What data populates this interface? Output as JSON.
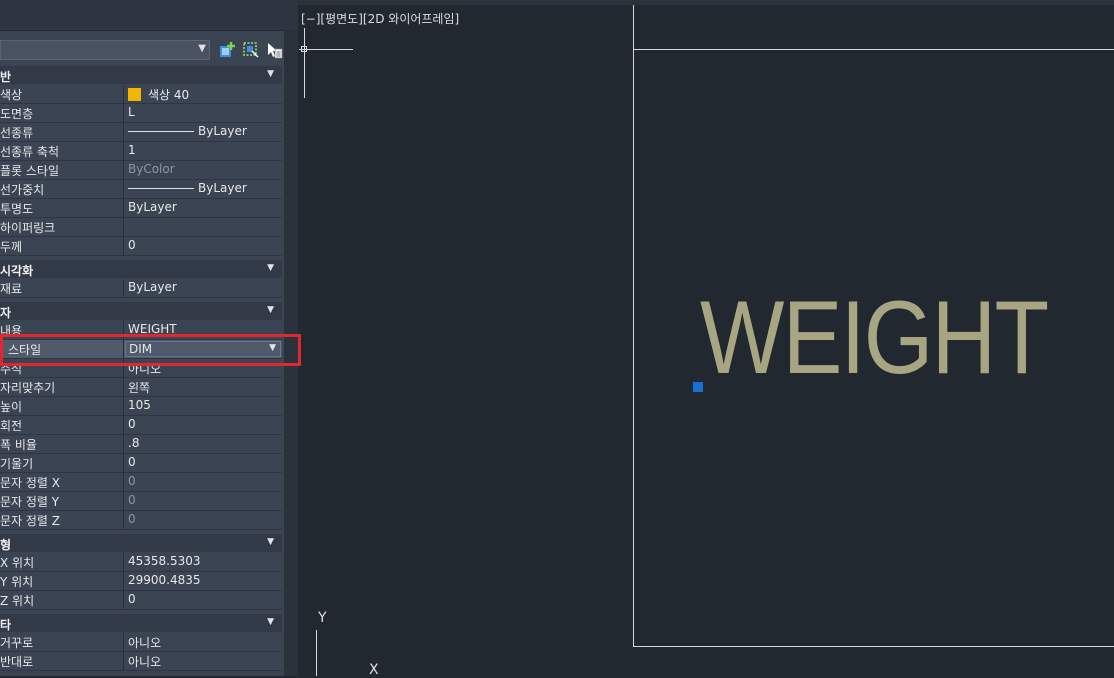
{
  "viewport": {
    "label": "[−][평면도][2D 와이어프레임]"
  },
  "canvas_text": "WEIGHT",
  "palette": {
    "categories": {
      "general": "반",
      "visualization": "시각화",
      "text": "자",
      "geometry": "형",
      "misc": "타"
    },
    "general_rows": [
      {
        "key": "색상",
        "value": "색상 40"
      },
      {
        "key": "도면층",
        "value": "L"
      },
      {
        "key": "선종류",
        "value": "ByLayer"
      },
      {
        "key": "선종류 축척",
        "value": "1"
      },
      {
        "key": "플롯 스타일",
        "value": "ByColor"
      },
      {
        "key": "선가중치",
        "value": "ByLayer"
      },
      {
        "key": "투명도",
        "value": "ByLayer"
      },
      {
        "key": "하이퍼링크",
        "value": ""
      },
      {
        "key": "두께",
        "value": "0"
      }
    ],
    "visual_rows": [
      {
        "key": "재료",
        "value": "ByLayer"
      }
    ],
    "text_rows": [
      {
        "key": "내용",
        "value": "WEIGHT"
      },
      {
        "key": "스타일",
        "value": "DIM"
      },
      {
        "key": "주석",
        "value": "아니오"
      },
      {
        "key": "자리맞추기",
        "value": "왼쪽"
      },
      {
        "key": "높이",
        "value": "105"
      },
      {
        "key": "회전",
        "value": "0"
      },
      {
        "key": "폭 비율",
        "value": ".8"
      },
      {
        "key": "기울기",
        "value": "0"
      },
      {
        "key": "문자 정렬 X",
        "value": "0"
      },
      {
        "key": "문자 정렬 Y",
        "value": "0"
      },
      {
        "key": "문자 정렬 Z",
        "value": "0"
      }
    ],
    "geometry_rows": [
      {
        "key": "X 위치",
        "value": "45358.5303"
      },
      {
        "key": "Y 위치",
        "value": "29900.4835"
      },
      {
        "key": "Z 위치",
        "value": "0"
      }
    ],
    "misc_rows": [
      {
        "key": "거꾸로",
        "value": "아니오"
      },
      {
        "key": "반대로",
        "value": "아니오"
      }
    ]
  },
  "ucs": {
    "x_label": "X",
    "y_label": "Y"
  },
  "colors": {
    "text_object": "#a8a582",
    "swatch_color40": "#f2b600",
    "highlight_box": "#e0262e",
    "grip": "#1670d8"
  }
}
